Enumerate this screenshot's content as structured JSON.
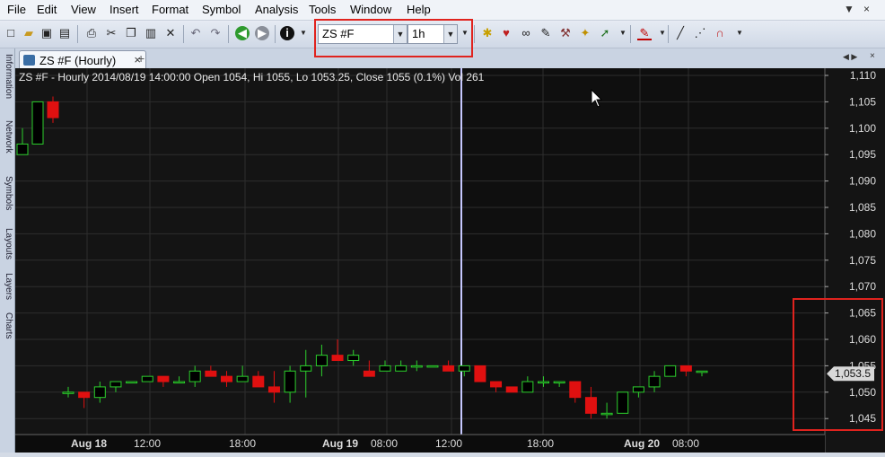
{
  "menu": [
    "File",
    "Edit",
    "View",
    "Insert",
    "Format",
    "Symbol",
    "Analysis",
    "Tools",
    "Window",
    "Help"
  ],
  "window_controls": [
    "▼",
    "×"
  ],
  "toolbar": {
    "symbol": "ZS #F",
    "interval": "1h",
    "icons": [
      "new-icon",
      "open-icon",
      "save-icon",
      "save-all-icon",
      "print-icon",
      "cut-icon",
      "copy-icon",
      "paste-icon",
      "delete-icon",
      "undo-icon",
      "redo-icon",
      "back-icon",
      "forward-icon",
      "info-icon"
    ]
  },
  "side_tabs": [
    "Information",
    "Network",
    "Symbols",
    "Layouts",
    "Layers",
    "Charts"
  ],
  "tab": {
    "title": "ZS #F (Hourly)",
    "close": "×",
    "add": "+"
  },
  "chart": {
    "info_line": "ZS #F - Hourly 2014/08/19 14:00:00 Open 1054, Hi 1055, Lo 1053.25, Close 1055 (0.1%) Vol 261",
    "last_price_label": "1,053.5",
    "colors": {
      "bg": "#141414",
      "bg_alt": "#0f0f0f",
      "grid": "#2e2e2e",
      "up": "#2ccf2c",
      "down": "#e01010",
      "cursor": "#c6c8ff",
      "highlight": "#e0231e"
    }
  },
  "chart_data": {
    "type": "candlestick",
    "y_ticks": [
      "1,110",
      "1,105",
      "1,100",
      "1,095",
      "1,090",
      "1,085",
      "1,080",
      "1,075",
      "1,070",
      "1,065",
      "1,060",
      "1,055",
      "1,050",
      "1,045"
    ],
    "ylim": [
      1042,
      1111
    ],
    "x_labels": [
      "Aug 18",
      "12:00",
      "18:00",
      "Aug 19",
      "08:00",
      "12:00",
      "18:00",
      "Aug 20",
      "08:00"
    ],
    "bars": [
      [
        1095,
        1100,
        1095,
        1097
      ],
      [
        1097,
        1105,
        1097,
        1105
      ],
      [
        1105,
        1106,
        1101,
        1102
      ],
      [
        1050,
        1051,
        1049,
        1050
      ],
      [
        1050,
        1050,
        1047,
        1049
      ],
      [
        1049,
        1052,
        1048,
        1051
      ],
      [
        1051,
        1052,
        1050,
        1052
      ],
      [
        1052,
        1052,
        1052,
        1052
      ],
      [
        1052,
        1053,
        1052,
        1053
      ],
      [
        1053,
        1053,
        1051,
        1052
      ],
      [
        1052,
        1053,
        1052,
        1052
      ],
      [
        1052,
        1055,
        1051,
        1054
      ],
      [
        1054,
        1055,
        1053,
        1053
      ],
      [
        1053,
        1054,
        1051,
        1052
      ],
      [
        1052,
        1055,
        1052,
        1053
      ],
      [
        1053,
        1054,
        1051,
        1051
      ],
      [
        1051,
        1054,
        1048,
        1050
      ],
      [
        1050,
        1055,
        1048,
        1054
      ],
      [
        1054,
        1058,
        1049,
        1055
      ],
      [
        1055,
        1059,
        1053,
        1057
      ],
      [
        1057,
        1060,
        1056,
        1056
      ],
      [
        1056,
        1058,
        1055,
        1057
      ],
      [
        1054,
        1056,
        1053,
        1053
      ],
      [
        1054,
        1056,
        1054,
        1055
      ],
      [
        1054,
        1056,
        1054,
        1055
      ],
      [
        1055,
        1056,
        1054,
        1055
      ],
      [
        1055,
        1055,
        1055,
        1055
      ],
      [
        1055,
        1056,
        1054,
        1054
      ],
      [
        1054,
        1055,
        1053,
        1055
      ],
      [
        1055,
        1055,
        1052,
        1052
      ],
      [
        1052,
        1052,
        1050,
        1051
      ],
      [
        1051,
        1051,
        1050,
        1050
      ],
      [
        1050,
        1053,
        1050,
        1052
      ],
      [
        1052,
        1053,
        1051,
        1052
      ],
      [
        1052,
        1052,
        1051,
        1052
      ],
      [
        1052,
        1052,
        1048,
        1049
      ],
      [
        1049,
        1051,
        1045,
        1046
      ],
      [
        1046,
        1048,
        1045,
        1046
      ],
      [
        1046,
        1050,
        1046,
        1050
      ],
      [
        1050,
        1051,
        1049,
        1051
      ],
      [
        1051,
        1054,
        1050,
        1053
      ],
      [
        1053,
        1055,
        1053,
        1055
      ],
      [
        1055,
        1055,
        1053,
        1054
      ],
      [
        1054,
        1054,
        1053,
        1054
      ]
    ]
  }
}
